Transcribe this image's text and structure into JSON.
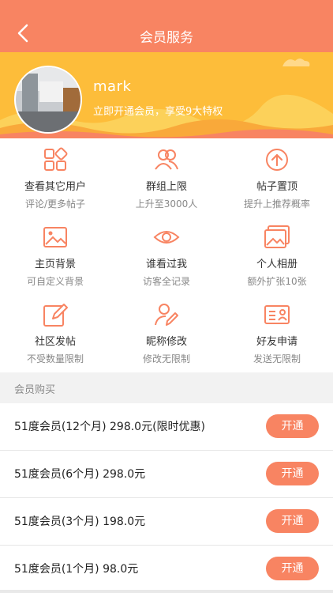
{
  "header": {
    "title": "会员服务"
  },
  "profile": {
    "username": "mark",
    "tagline": "立即开通会员，享受9大特权"
  },
  "features": [
    {
      "label": "查看其它用户",
      "sub": "评论/更多帖子",
      "icon": "apps-icon"
    },
    {
      "label": "群组上限",
      "sub": "上升至3000人",
      "icon": "group-icon"
    },
    {
      "label": "帖子置顶",
      "sub": "提升上推荐概率",
      "icon": "arrow-up-circle-icon"
    },
    {
      "label": "主页背景",
      "sub": "可自定义背景",
      "icon": "image-icon"
    },
    {
      "label": "谁看过我",
      "sub": "访客全记录",
      "icon": "eye-icon"
    },
    {
      "label": "个人相册",
      "sub": "额外扩张10张",
      "icon": "album-icon"
    },
    {
      "label": "社区发帖",
      "sub": "不受数量限制",
      "icon": "edit-icon"
    },
    {
      "label": "昵称修改",
      "sub": "修改无限制",
      "icon": "user-edit-icon"
    },
    {
      "label": "好友申请",
      "sub": "发送无限制",
      "icon": "id-card-icon"
    }
  ],
  "purchase": {
    "section_label": "会员购买",
    "plans": [
      {
        "name": "51度会员(12个月) 298.0元(限时优惠)",
        "button": "开通"
      },
      {
        "name": "51度会员(6个月) 298.0元",
        "button": "开通"
      },
      {
        "name": "51度会员(3个月) 198.0元",
        "button": "开通"
      },
      {
        "name": "51度会员(1个月) 98.0元",
        "button": "开通"
      }
    ]
  },
  "colors": {
    "accent": "#f88462",
    "banner": "#fdbd3a"
  }
}
